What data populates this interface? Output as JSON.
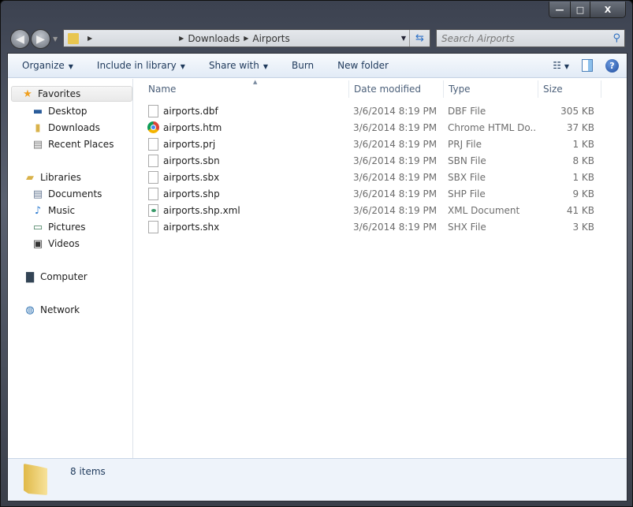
{
  "window": {
    "minimize": "—",
    "maximize": "□",
    "close": "X"
  },
  "address": {
    "segments": [
      "Downloads",
      "Airports"
    ]
  },
  "search": {
    "placeholder": "Search Airports"
  },
  "toolbar": {
    "organize": "Organize",
    "include": "Include in library",
    "share": "Share with",
    "burn": "Burn",
    "new_folder": "New folder",
    "help": "?"
  },
  "nav": {
    "favorites": "Favorites",
    "desktop": "Desktop",
    "downloads": "Downloads",
    "recent": "Recent Places",
    "libraries": "Libraries",
    "documents": "Documents",
    "music": "Music",
    "pictures": "Pictures",
    "videos": "Videos",
    "computer": "Computer",
    "network": "Network"
  },
  "columns": {
    "name": "Name",
    "date": "Date modified",
    "type": "Type",
    "size": "Size"
  },
  "files": [
    {
      "name": "airports.dbf",
      "date": "3/6/2014 8:19 PM",
      "type": "DBF File",
      "size": "305 KB",
      "icon": "file"
    },
    {
      "name": "airports.htm",
      "date": "3/6/2014 8:19 PM",
      "type": "Chrome HTML Do...",
      "size": "37 KB",
      "icon": "chrome"
    },
    {
      "name": "airports.prj",
      "date": "3/6/2014 8:19 PM",
      "type": "PRJ File",
      "size": "1 KB",
      "icon": "file"
    },
    {
      "name": "airports.sbn",
      "date": "3/6/2014 8:19 PM",
      "type": "SBN File",
      "size": "8 KB",
      "icon": "file"
    },
    {
      "name": "airports.sbx",
      "date": "3/6/2014 8:19 PM",
      "type": "SBX File",
      "size": "1 KB",
      "icon": "file"
    },
    {
      "name": "airports.shp",
      "date": "3/6/2014 8:19 PM",
      "type": "SHP File",
      "size": "9 KB",
      "icon": "file"
    },
    {
      "name": "airports.shp.xml",
      "date": "3/6/2014 8:19 PM",
      "type": "XML Document",
      "size": "41 KB",
      "icon": "xml"
    },
    {
      "name": "airports.shx",
      "date": "3/6/2014 8:19 PM",
      "type": "SHX File",
      "size": "3 KB",
      "icon": "file"
    }
  ],
  "status": {
    "count": "8 items"
  }
}
